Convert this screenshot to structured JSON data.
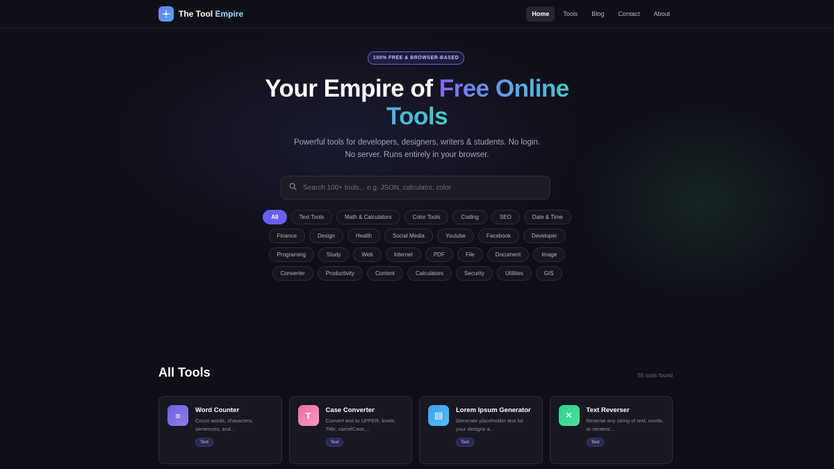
{
  "brand": {
    "name_main": "The Tool ",
    "name_accent": "Empire",
    "logo_icon": "compass-icon"
  },
  "nav": {
    "links": [
      {
        "label": "Home",
        "active": true
      },
      {
        "label": "Tools",
        "active": false
      },
      {
        "label": "Blog",
        "active": false
      },
      {
        "label": "Contact",
        "active": false
      },
      {
        "label": "About",
        "active": false
      }
    ]
  },
  "hero": {
    "badge": "100% FREE & BROWSER-BASED",
    "title_plain": "Your Empire of ",
    "title_gradient_1": "Free Online",
    "title_gradient_2": "Tools",
    "subtitle": "Powerful tools for developers, designers, writers & students. No login. No server. Runs entirely in your browser."
  },
  "search": {
    "placeholder": "Search 100+ tools... e.g. JSON, calculator, color",
    "value": "",
    "icon": "search-icon"
  },
  "categories": [
    {
      "label": "All",
      "active": true
    },
    {
      "label": "Text Tools"
    },
    {
      "label": "Math & Calculators"
    },
    {
      "label": "Color Tools"
    },
    {
      "label": "Coding"
    },
    {
      "label": "SEO"
    },
    {
      "label": "Date & Time"
    },
    {
      "label": "Finance"
    },
    {
      "label": "Design"
    },
    {
      "label": "Health"
    },
    {
      "label": "Social Media"
    },
    {
      "label": "Youtube"
    },
    {
      "label": "Facebook"
    },
    {
      "label": "Developer"
    },
    {
      "label": "Programing"
    },
    {
      "label": "Study"
    },
    {
      "label": "Web"
    },
    {
      "label": "Internet"
    },
    {
      "label": "PDF"
    },
    {
      "label": "File"
    },
    {
      "label": "Document"
    },
    {
      "label": "Image"
    },
    {
      "label": "Converter"
    },
    {
      "label": "Productivity"
    },
    {
      "label": "Content"
    },
    {
      "label": "Calculators"
    },
    {
      "label": "Security"
    },
    {
      "label": "Utilities"
    },
    {
      "label": "GIS"
    }
  ],
  "tools_section": {
    "title": "All Tools",
    "count": "55 tools found",
    "cards": [
      {
        "title": "Word Counter",
        "desc": "Count words, characters, sentences, and...",
        "tag": "Text",
        "icon": "lines-icon",
        "glyph": "≡",
        "color_from": "#6a63d8",
        "color_to": "#8f7cf0"
      },
      {
        "title": "Case Converter",
        "desc": "Convert text to UPPER, lower, Title, camelCase,...",
        "tag": "Text",
        "icon": "text-t-icon",
        "glyph": "T",
        "color_from": "#f06ca8",
        "color_to": "#f59ac0"
      },
      {
        "title": "Lorem Ipsum Generator",
        "desc": "Generate placeholder text for your designs a...",
        "tag": "Text",
        "icon": "document-icon",
        "glyph": "▤",
        "color_from": "#3f9ef0",
        "color_to": "#4fc0f0"
      },
      {
        "title": "Text Reverser",
        "desc": "Reverse any string of text, words, or sentenc...",
        "tag": "Text",
        "icon": "swap-icon",
        "glyph": "✕",
        "color_from": "#2fcf8a",
        "color_to": "#4fe0a0"
      }
    ]
  }
}
